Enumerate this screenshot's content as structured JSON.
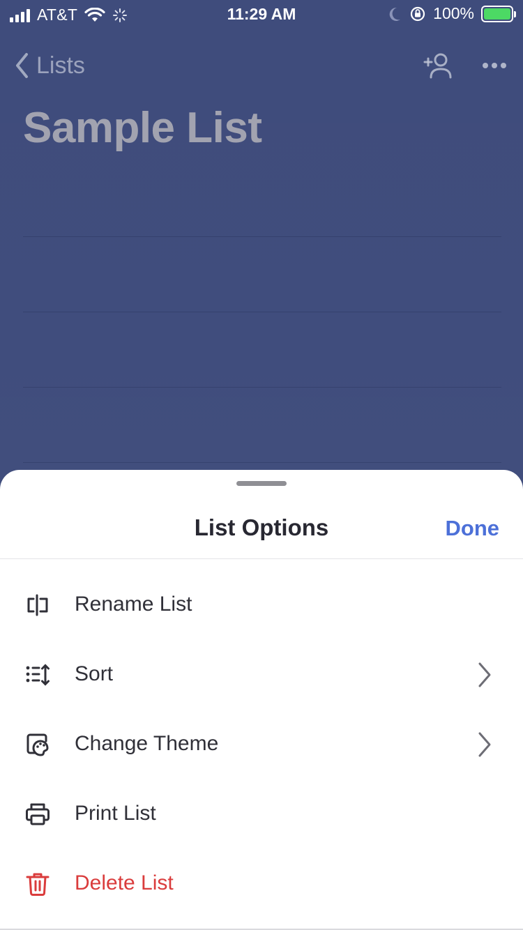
{
  "status_bar": {
    "carrier": "AT&T",
    "time": "11:29 AM",
    "battery_percent": "100%",
    "battery_level": 1.0,
    "battery_color": "#4cd964"
  },
  "nav": {
    "back_label": "Lists",
    "add_member_icon": "add-person-icon",
    "more_icon": "more-icon"
  },
  "list": {
    "title": "Sample List"
  },
  "sheet": {
    "title": "List Options",
    "done_label": "Done",
    "accent_color": "#4a6ed8",
    "items": [
      {
        "label": "Rename List",
        "icon": "rename-icon",
        "has_chevron": false
      },
      {
        "label": "Sort",
        "icon": "sort-icon",
        "has_chevron": true
      },
      {
        "label": "Change Theme",
        "icon": "theme-icon",
        "has_chevron": true
      },
      {
        "label": "Print List",
        "icon": "print-icon",
        "has_chevron": false
      },
      {
        "label": "Delete List",
        "icon": "trash-icon",
        "has_chevron": false,
        "color": "#d93838"
      }
    ]
  }
}
